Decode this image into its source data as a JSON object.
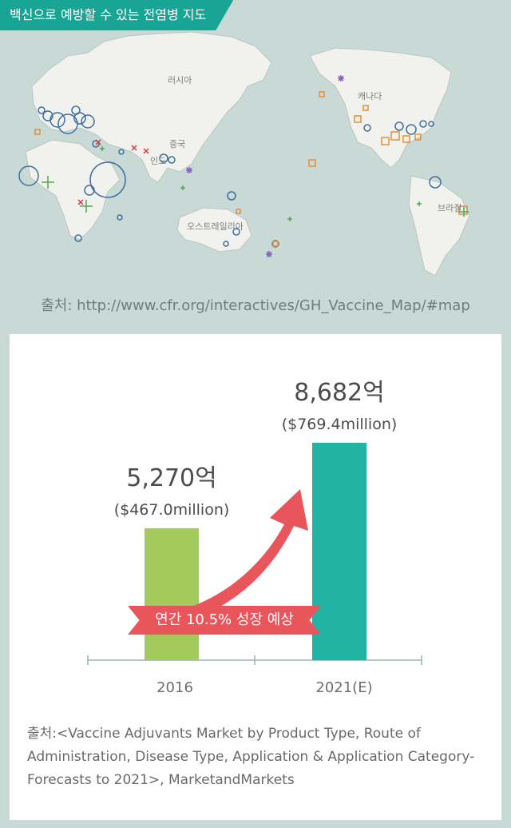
{
  "map": {
    "title": "백신으로 예방할 수 있는 전염병 지도",
    "source": "출처: http://www.cfr.org/interactives/GH_Vaccine_Map/#map",
    "country_labels": [
      "러시아",
      "중국",
      "인도",
      "캐나다",
      "브라질",
      "오스트레일리아"
    ]
  },
  "chart_data": {
    "type": "bar",
    "categories": [
      "2016",
      "2021(E)"
    ],
    "values": [
      5270,
      8682
    ],
    "unit": "억",
    "value_labels": [
      "5,270억",
      "8,682억"
    ],
    "sub_labels": [
      "($467.0million)",
      "($769.4million)"
    ],
    "bar_colors": [
      "#a4ca5d",
      "#21b3a3"
    ],
    "annotation": "연간 10.5% 성장 예상",
    "title": "",
    "xlabel": "",
    "ylabel": "",
    "grid": false
  },
  "source_note": "출처:<Vaccine Adjuvants Market by Product Type, Route of Administration, Disease Type, Application & Application Category-Forecasts to 2021>, MarketandMarkets"
}
